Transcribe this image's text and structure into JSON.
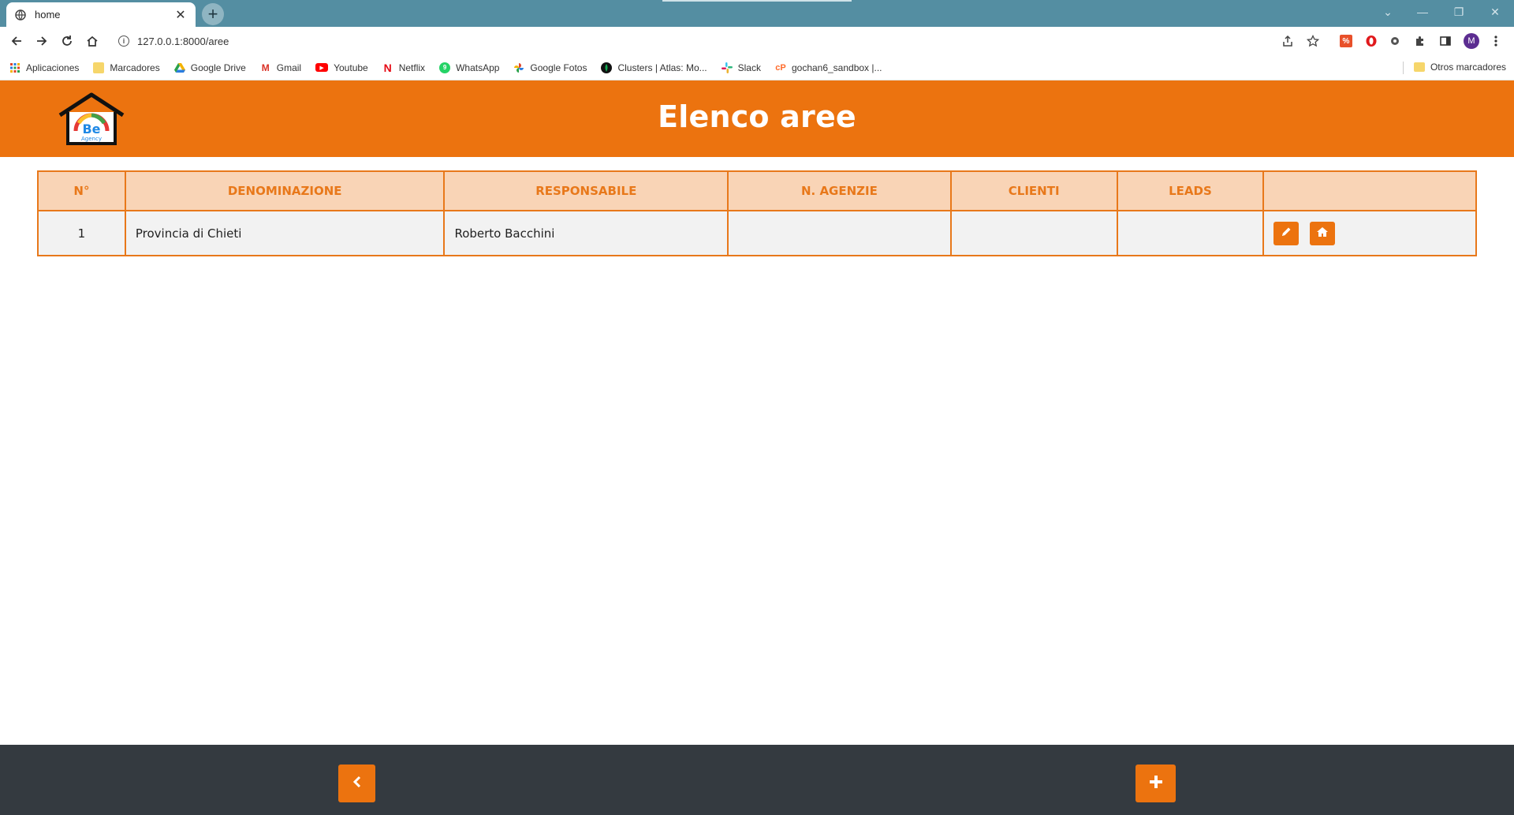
{
  "browser": {
    "tab_title": "home",
    "url": "127.0.0.1:8000/aree",
    "profile_initial": "M",
    "bookmarks": [
      {
        "label": "Aplicaciones",
        "icon": "apps-grid-icon"
      },
      {
        "label": "Marcadores",
        "icon": "folder-icon"
      },
      {
        "label": "Google Drive",
        "icon": "google-drive-icon"
      },
      {
        "label": "Gmail",
        "icon": "gmail-icon"
      },
      {
        "label": "Youtube",
        "icon": "youtube-icon"
      },
      {
        "label": "Netflix",
        "icon": "netflix-icon"
      },
      {
        "label": "WhatsApp",
        "icon": "whatsapp-icon"
      },
      {
        "label": "Google Fotos",
        "icon": "google-photos-icon"
      },
      {
        "label": "Clusters | Atlas: Mo...",
        "icon": "mongodb-icon"
      },
      {
        "label": "Slack",
        "icon": "slack-icon"
      },
      {
        "label": "gochan6_sandbox |...",
        "icon": "cpanel-icon"
      }
    ],
    "other_bookmarks": "Otros marcadores"
  },
  "header": {
    "title": "Elenco aree",
    "logo_text": "Be Agency"
  },
  "table": {
    "columns": [
      "N°",
      "DENOMINAZIONE",
      "RESPONSABILE",
      "N. AGENZIE",
      "CLIENTI",
      "LEADS",
      ""
    ],
    "rows": [
      {
        "n": "1",
        "denominazione": "Provincia di Chieti",
        "responsabile": "Roberto Bacchini",
        "agenzie": "",
        "clienti": "",
        "leads": ""
      }
    ]
  },
  "colors": {
    "accent": "#ec730f",
    "header_bg": "#f9d4b6",
    "footer_bg": "#343a40",
    "tabstrip": "#548ea2"
  }
}
